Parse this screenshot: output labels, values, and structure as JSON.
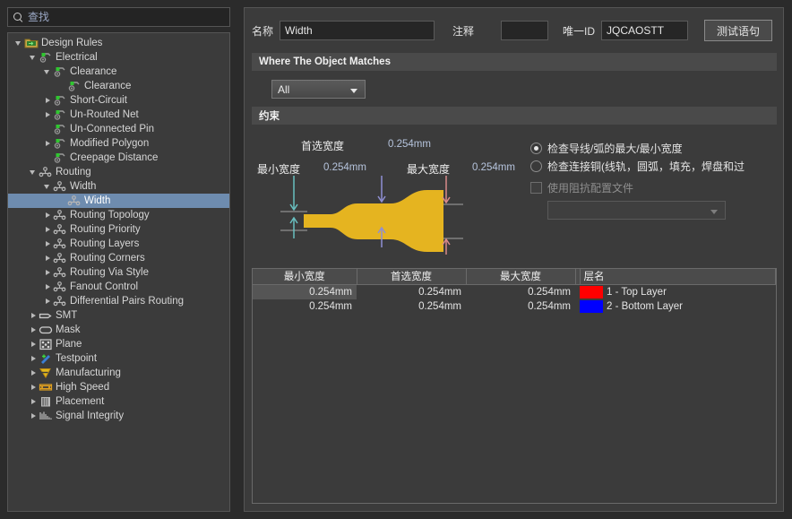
{
  "search": {
    "placeholder": "查找",
    "icon": "search-icon"
  },
  "tree": {
    "items": [
      {
        "label": "Design Rules",
        "depth": 0,
        "expander": "open",
        "icon": "design-rules-folder-icon",
        "selected": false
      },
      {
        "label": "Electrical",
        "depth": 1,
        "expander": "open",
        "icon": "electrical-rule-icon",
        "selected": false
      },
      {
        "label": "Clearance",
        "depth": 2,
        "expander": "open",
        "icon": "electrical-rule-icon",
        "selected": false
      },
      {
        "label": "Clearance",
        "depth": 3,
        "expander": "none",
        "icon": "electrical-rule-icon",
        "selected": false
      },
      {
        "label": "Short-Circuit",
        "depth": 2,
        "expander": "closed",
        "icon": "electrical-rule-icon",
        "selected": false
      },
      {
        "label": "Un-Routed Net",
        "depth": 2,
        "expander": "closed",
        "icon": "electrical-rule-icon",
        "selected": false
      },
      {
        "label": "Un-Connected Pin",
        "depth": 2,
        "expander": "none",
        "icon": "electrical-rule-icon",
        "selected": false
      },
      {
        "label": "Modified Polygon",
        "depth": 2,
        "expander": "closed",
        "icon": "electrical-rule-icon",
        "selected": false
      },
      {
        "label": "Creepage Distance",
        "depth": 2,
        "expander": "none",
        "icon": "electrical-rule-icon",
        "selected": false
      },
      {
        "label": "Routing",
        "depth": 1,
        "expander": "open",
        "icon": "routing-rule-icon",
        "selected": false
      },
      {
        "label": "Width",
        "depth": 2,
        "expander": "open",
        "icon": "routing-rule-icon",
        "selected": false
      },
      {
        "label": "Width",
        "depth": 3,
        "expander": "none",
        "icon": "routing-rule-icon",
        "selected": true
      },
      {
        "label": "Routing Topology",
        "depth": 2,
        "expander": "closed",
        "icon": "routing-rule-icon",
        "selected": false
      },
      {
        "label": "Routing Priority",
        "depth": 2,
        "expander": "closed",
        "icon": "routing-rule-icon",
        "selected": false
      },
      {
        "label": "Routing Layers",
        "depth": 2,
        "expander": "closed",
        "icon": "routing-rule-icon",
        "selected": false
      },
      {
        "label": "Routing Corners",
        "depth": 2,
        "expander": "closed",
        "icon": "routing-rule-icon",
        "selected": false
      },
      {
        "label": "Routing Via Style",
        "depth": 2,
        "expander": "closed",
        "icon": "routing-rule-icon",
        "selected": false
      },
      {
        "label": "Fanout Control",
        "depth": 2,
        "expander": "closed",
        "icon": "routing-rule-icon",
        "selected": false
      },
      {
        "label": "Differential Pairs Routing",
        "depth": 2,
        "expander": "closed",
        "icon": "routing-rule-icon",
        "selected": false
      },
      {
        "label": "SMT",
        "depth": 1,
        "expander": "closed",
        "icon": "smt-icon",
        "selected": false
      },
      {
        "label": "Mask",
        "depth": 1,
        "expander": "closed",
        "icon": "mask-icon",
        "selected": false
      },
      {
        "label": "Plane",
        "depth": 1,
        "expander": "closed",
        "icon": "plane-icon",
        "selected": false
      },
      {
        "label": "Testpoint",
        "depth": 1,
        "expander": "closed",
        "icon": "testpoint-icon",
        "selected": false
      },
      {
        "label": "Manufacturing",
        "depth": 1,
        "expander": "closed",
        "icon": "manufacturing-icon",
        "selected": false
      },
      {
        "label": "High Speed",
        "depth": 1,
        "expander": "closed",
        "icon": "high-speed-icon",
        "selected": false
      },
      {
        "label": "Placement",
        "depth": 1,
        "expander": "closed",
        "icon": "placement-icon",
        "selected": false
      },
      {
        "label": "Signal Integrity",
        "depth": 1,
        "expander": "closed",
        "icon": "signal-integrity-icon",
        "selected": false
      }
    ]
  },
  "form": {
    "name_label": "名称",
    "name_value": "Width",
    "comment_label": "注释",
    "comment_value": "",
    "uid_label": "唯一ID",
    "uid_value": "JQCAOSTT",
    "test_query_button": "测试语句"
  },
  "where_section": {
    "title": "Where The Object Matches",
    "scope_selected": "All"
  },
  "constraint_section": {
    "title": "约束",
    "preferred_label": "首选宽度",
    "preferred_value": "0.254mm",
    "min_label": "最小宽度",
    "min_value": "0.254mm",
    "max_label": "最大宽度",
    "max_value": "0.254mm",
    "options": {
      "check_track_arc": "检查导线/弧的最大/最小宽度",
      "check_copper": "检查连接铜(线轨，圆弧，填充，焊盘和过",
      "use_impedance_profile": "使用阻抗配置文件",
      "impedance_profile_value": ""
    }
  },
  "table": {
    "headers": [
      "最小宽度",
      "首选宽度",
      "最大宽度",
      "",
      "层名"
    ],
    "rows": [
      {
        "min": "0.254mm",
        "preferred": "0.254mm",
        "max": "0.254mm",
        "color": "#ff0000",
        "layer": "1 - Top Layer",
        "selected": true
      },
      {
        "min": "0.254mm",
        "preferred": "0.254mm",
        "max": "0.254mm",
        "color": "#0000ff",
        "layer": "2 - Bottom Layer",
        "selected": false
      }
    ]
  },
  "colors": {
    "panel_bg": "#3b3b3b",
    "window_bg": "#2b2b2b",
    "selection": "#6e8caf",
    "track_gold": "#e5b420",
    "value_blue": "#b6c4dd"
  }
}
